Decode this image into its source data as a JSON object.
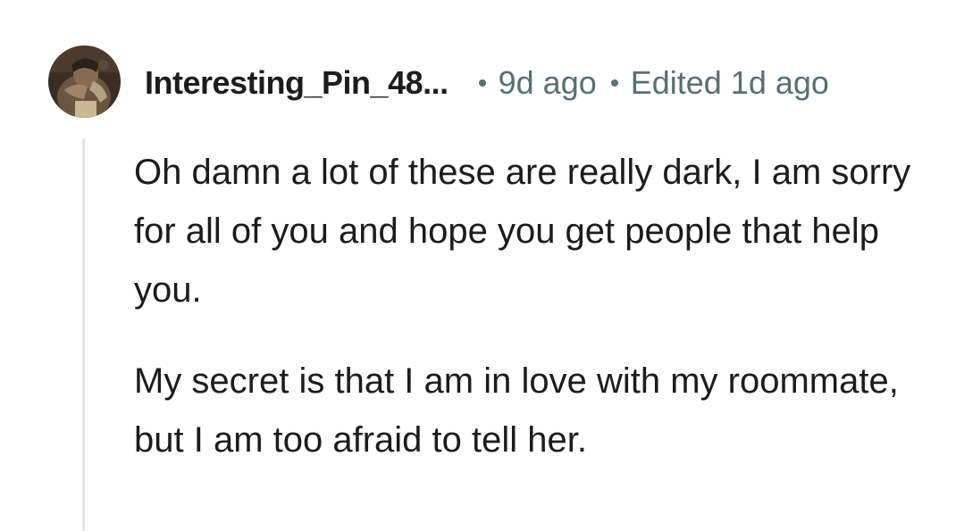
{
  "comment": {
    "author": {
      "username": "Interesting_Pin_48...",
      "avatar_icon": "user-avatar-icon"
    },
    "timestamp": "9d ago",
    "edited": "Edited 1d ago",
    "paragraphs": [
      "Oh damn a lot of these are really dark, I am sorry for all of you and hope you get people that help you.",
      "My secret is that I am in love with my roommate, but I am too afraid to tell her."
    ]
  },
  "colors": {
    "text_primary": "#1c1c1c",
    "text_meta": "#576f76",
    "thread_line": "#e3e6e8",
    "background": "#ffffff"
  }
}
